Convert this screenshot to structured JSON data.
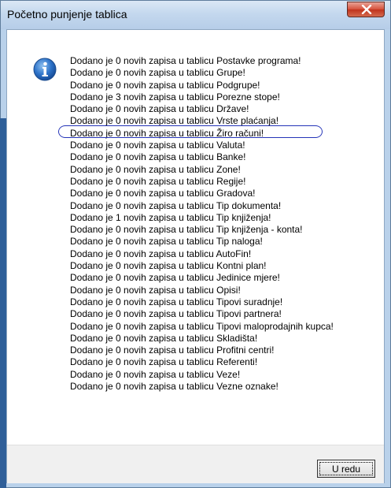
{
  "window": {
    "title": "Početno punjenje tablica",
    "close_label": "Close"
  },
  "dialog": {
    "icon": "info-icon",
    "messages": [
      "Dodano je 0 novih zapisa u tablicu Postavke programa!",
      "Dodano je 0 novih zapisa u tablicu Grupe!",
      "Dodano je 0 novih zapisa u tablicu Podgrupe!",
      "Dodano je 3 novih zapisa u tablicu Porezne stope!",
      "Dodano je 0 novih zapisa u tablicu Države!",
      "Dodano je 0 novih zapisa u tablicu Vrste plaćanja!",
      "Dodano je 0 novih zapisa u tablicu Žiro računi!",
      "Dodano je 0 novih zapisa u tablicu Valuta!",
      "Dodano je 0 novih zapisa u tablicu Banke!",
      "Dodano je 0 novih zapisa u tablicu Zone!",
      "Dodano je 0 novih zapisa u tablicu Regije!",
      "Dodano je 0 novih zapisa u tablicu Gradova!",
      "Dodano je 0 novih zapisa u tablicu Tip dokumenta!",
      "Dodano je 1 novih zapisa u tablicu Tip knjiženja!",
      "Dodano je 0 novih zapisa u tablicu Tip knjiženja - konta!",
      "Dodano je 0 novih zapisa u tablicu Tip naloga!",
      "Dodano je 0 novih zapisa u tablicu AutoFin!",
      "Dodano je 0 novih zapisa u tablicu Kontni plan!",
      "Dodano je 0 novih zapisa u tablicu Jedinice mjere!",
      "Dodano je 0 novih zapisa u tablicu Opisi!",
      "Dodano je 0 novih zapisa u tablicu Tipovi suradnje!",
      "Dodano je 0 novih zapisa u tablicu Tipovi partnera!",
      "Dodano je 0 novih zapisa u tablicu Tipovi maloprodajnih kupca!",
      "Dodano je 0 novih zapisa u tablicu Skladišta!",
      "Dodano je 0 novih zapisa u tablicu Profitni centri!",
      "Dodano je 0 novih zapisa u tablicu Referenti!",
      "Dodano je 0 novih zapisa u tablicu Veze!",
      "Dodano je 0 novih zapisa u tablicu Vezne oznake!"
    ],
    "highlighted_index": 3,
    "ok_label": "U redu"
  },
  "colors": {
    "highlight": "#2534b8",
    "title_bar": "#c4d8ee",
    "close_button": "#c0331c"
  }
}
